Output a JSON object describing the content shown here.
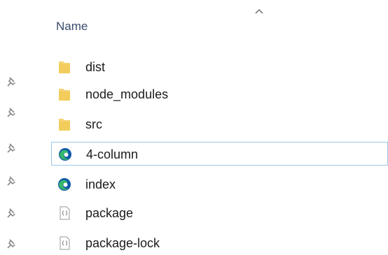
{
  "column_header": {
    "name_label": "Name",
    "sort": "ascending"
  },
  "files": [
    {
      "name": "dist",
      "icon": "folder-icon",
      "type": "folder"
    },
    {
      "name": "node_modules",
      "icon": "folder-icon",
      "type": "folder"
    },
    {
      "name": "src",
      "icon": "folder-icon",
      "type": "folder"
    },
    {
      "name": "4-column",
      "icon": "edge-html-icon",
      "type": "html",
      "selected": true
    },
    {
      "name": "index",
      "icon": "edge-html-icon",
      "type": "html"
    },
    {
      "name": "package",
      "icon": "json-file-icon",
      "type": "json"
    },
    {
      "name": "package-lock",
      "icon": "json-file-icon",
      "type": "json"
    }
  ],
  "colors": {
    "folder": "#f5d372",
    "folder_tab": "#e8bf4e",
    "edge_blue": "#0c59a8",
    "edge_green": "#38b66b",
    "selection_border": "#9cc7ea",
    "header_text": "#3a4a6a"
  }
}
